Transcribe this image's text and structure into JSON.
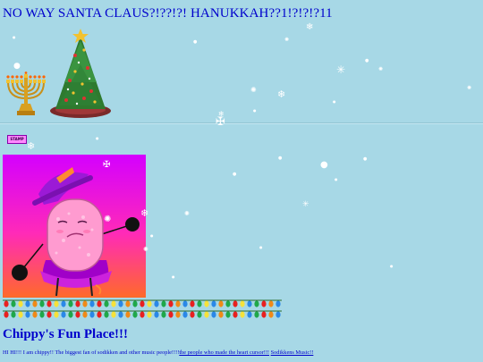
{
  "page": {
    "title": "NO WAY SANTA CLAUS?!??!?! HANUKKAH??1!?!?!?11",
    "badge_text": "STAMP"
  },
  "decorations": {
    "icons": [
      "menorah-icon",
      "christmas-tree-icon",
      "snowflake-icon",
      "christmas-lights-icon"
    ],
    "colors": {
      "background": "#a7d8e6",
      "text": "#0000cc",
      "portrait_top": "#d400ff",
      "portrait_bottom": "#ff6a2a"
    }
  },
  "profile": {
    "heading": "Chippy's Fun Place!!!",
    "bio_text": "HI HI!!! I am chippy!! The biggest fan of sodikken and other music people!!!!",
    "link_1": "the people who made the heart cursor!!!",
    "link_2": "Sodikkens Music!!"
  }
}
